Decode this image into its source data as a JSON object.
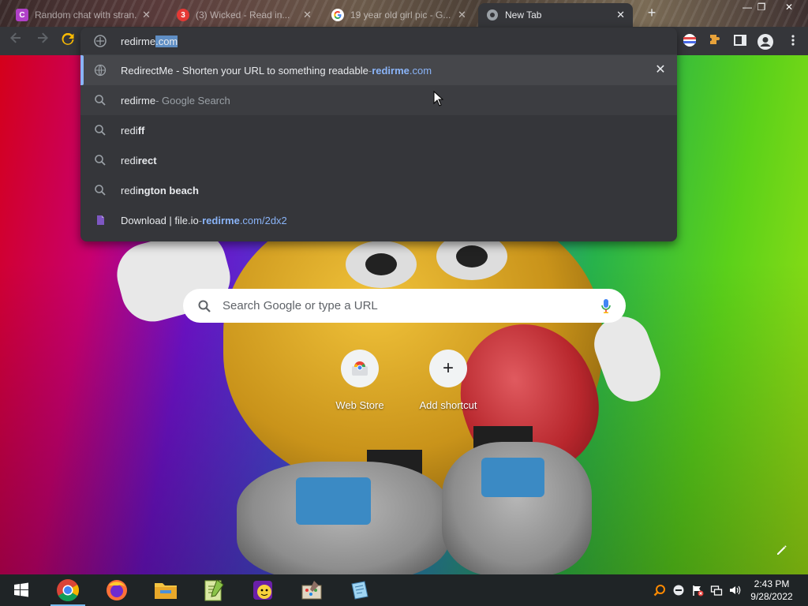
{
  "tabs": [
    {
      "title": "Random chat with stran...",
      "close": "✕"
    },
    {
      "title": "(3) Wicked - Read in...",
      "close": "✕"
    },
    {
      "title": "19 year old girl pic - G...",
      "close": "✕"
    },
    {
      "title": "New Tab",
      "close": "✕",
      "active": true
    }
  ],
  "new_tab": "+",
  "window_controls": {
    "minimize": "—",
    "maximize": "❐",
    "close": "✕"
  },
  "omnibox": {
    "typed": "redirme",
    "autocomplete": ".com",
    "suggestions": [
      {
        "icon": "site-icon",
        "title": "RedirectMe - Shorten your URL to something readable",
        "sep": " - ",
        "url_bold": "redirme",
        "url_rest": ".com",
        "remove": "✕"
      },
      {
        "icon": "search-icon",
        "prefix": "redirme",
        "suffix": " - Google Search"
      },
      {
        "icon": "search-icon",
        "prefix": "redi",
        "bold": "ff"
      },
      {
        "icon": "search-icon",
        "prefix": "redi",
        "bold": "rect"
      },
      {
        "icon": "search-icon",
        "prefix": "redi",
        "bold": "ngton beach"
      },
      {
        "icon": "file-io-icon",
        "title": "Download | file.io",
        "sep": " - ",
        "url_bold": "redirme",
        "url_rest": ".com/2dx2"
      }
    ]
  },
  "ntp": {
    "search_placeholder": "Search Google or type a URL",
    "shortcuts": [
      {
        "label": "Web Store",
        "icon": "webstore-icon"
      },
      {
        "label": "Add shortcut",
        "icon": "plus-icon",
        "glyph": "+"
      }
    ]
  },
  "taskbar": {
    "time": "2:43 PM",
    "date": "9/28/2022",
    "apps": [
      "windows-start",
      "chrome",
      "firefox",
      "file-explorer",
      "notepad-plus",
      "yahoo-messenger",
      "paint",
      "notepad"
    ]
  },
  "colors": {
    "accent": "#8ab4f8",
    "omnibox_bg": "#35363a",
    "taskbar_bg": "#1f2426"
  }
}
